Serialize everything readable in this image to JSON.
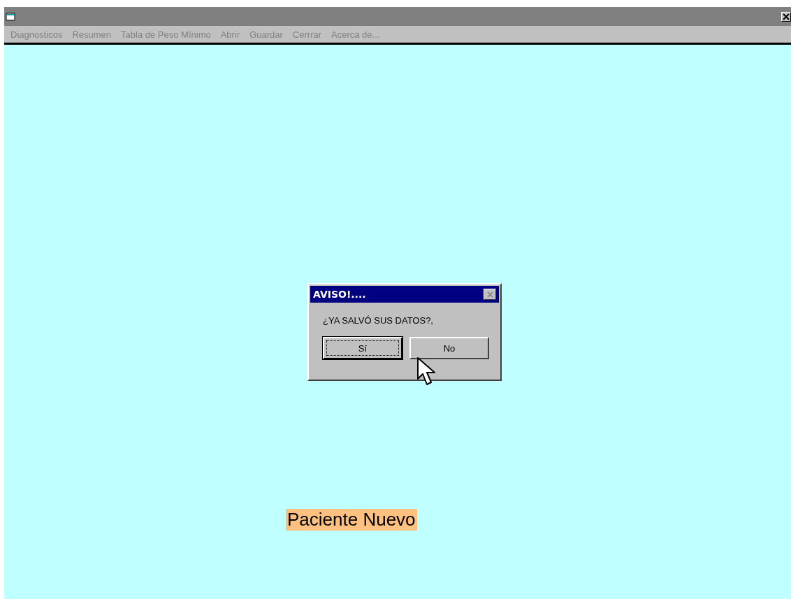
{
  "menu": [
    {
      "label": "Diagnosticos",
      "disabled": true
    },
    {
      "label": "Resumen",
      "disabled": true
    },
    {
      "label": "Tabla de Peso Mínimo",
      "disabled": true
    },
    {
      "label": "Abrir",
      "disabled": true
    },
    {
      "label": "Guardar",
      "disabled": true
    },
    {
      "label": "Cerrrar",
      "disabled": true
    },
    {
      "label": "Acerca de...",
      "disabled": true
    }
  ],
  "dialog": {
    "title": "AVISO!....",
    "message": "¿YA SALVÓ SUS DATOS?,",
    "buttons": [
      {
        "label": "Sí",
        "focused": true
      },
      {
        "label": "No",
        "focused": false
      }
    ]
  },
  "status_label": "Paciente Nuevo"
}
